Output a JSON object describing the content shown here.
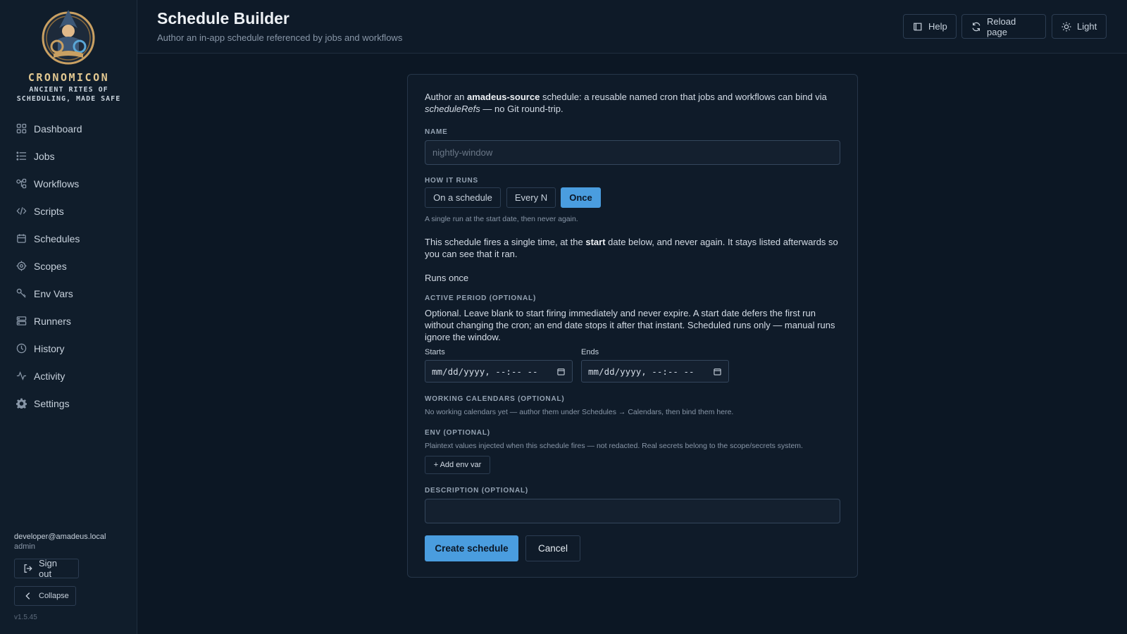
{
  "brand": {
    "name": "CRONOMICON",
    "tagline_line1": "ANCIENT RITES OF",
    "tagline_line2": "SCHEDULING, MADE SAFE"
  },
  "sidebar": {
    "items": [
      {
        "label": "Dashboard",
        "icon": "grid-icon"
      },
      {
        "label": "Jobs",
        "icon": "list-icon"
      },
      {
        "label": "Workflows",
        "icon": "workflow-icon"
      },
      {
        "label": "Scripts",
        "icon": "code-icon"
      },
      {
        "label": "Schedules",
        "icon": "calendar-icon"
      },
      {
        "label": "Scopes",
        "icon": "target-icon"
      },
      {
        "label": "Env Vars",
        "icon": "key-icon"
      },
      {
        "label": "Runners",
        "icon": "server-icon"
      },
      {
        "label": "History",
        "icon": "clock-icon"
      },
      {
        "label": "Activity",
        "icon": "activity-icon"
      },
      {
        "label": "Settings",
        "icon": "gear-icon"
      }
    ],
    "user_email": "developer@amadeus.local",
    "user_role": "admin",
    "sign_out": "Sign out",
    "collapse": "Collapse",
    "version": "v1.5.45"
  },
  "header": {
    "title": "Schedule Builder",
    "subtitle": "Author an in-app schedule referenced by jobs and workflows",
    "help": "Help",
    "reload": "Reload page",
    "theme": "Light"
  },
  "form": {
    "intro_pre": "Author an ",
    "intro_bold": "amadeus-source",
    "intro_mid": " schedule: a reusable named cron that jobs and workflows can bind via ",
    "intro_italic": "scheduleRefs",
    "intro_post": " — no Git round-trip.",
    "name_label": "NAME",
    "name_placeholder": "nightly-window",
    "name_value": "",
    "how_label": "HOW IT RUNS",
    "modes": [
      "On a schedule",
      "Every N",
      "Once"
    ],
    "active_mode": "Once",
    "mode_hint": "A single run at the start date, then never again.",
    "once_pre": "This schedule fires a single time, at the ",
    "once_bold": "start",
    "once_post": " date below, and never again. It stays listed afterwards so you can see that it ran.",
    "runs_summary": "Runs once",
    "active_label": "ACTIVE PERIOD (OPTIONAL)",
    "active_desc": "Optional. Leave blank to start firing immediately and never expire. A start date defers the first run without changing the cron; an end date stops it after that instant. Scheduled runs only — manual runs ignore the window.",
    "starts_label": "Starts",
    "ends_label": "Ends",
    "starts_value": "mm/dd/yyyy, --:-- --",
    "ends_value": "mm/dd/yyyy, --:-- --",
    "calendars_label": "WORKING CALENDARS (OPTIONAL)",
    "calendars_hint": "No working calendars yet — author them under Schedules → Calendars, then bind them here.",
    "env_label": "ENV (OPTIONAL)",
    "env_hint": "Plaintext values injected when this schedule fires — not redacted. Real secrets belong to the scope/secrets system.",
    "add_env": "+ Add env var",
    "description_label": "DESCRIPTION (OPTIONAL)",
    "description_value": "",
    "create": "Create schedule",
    "cancel": "Cancel"
  },
  "colors": {
    "accent": "#4a9ddf",
    "background": "#0c1724",
    "sidebar": "#101d2b",
    "brand_gold": "#e2c891"
  }
}
